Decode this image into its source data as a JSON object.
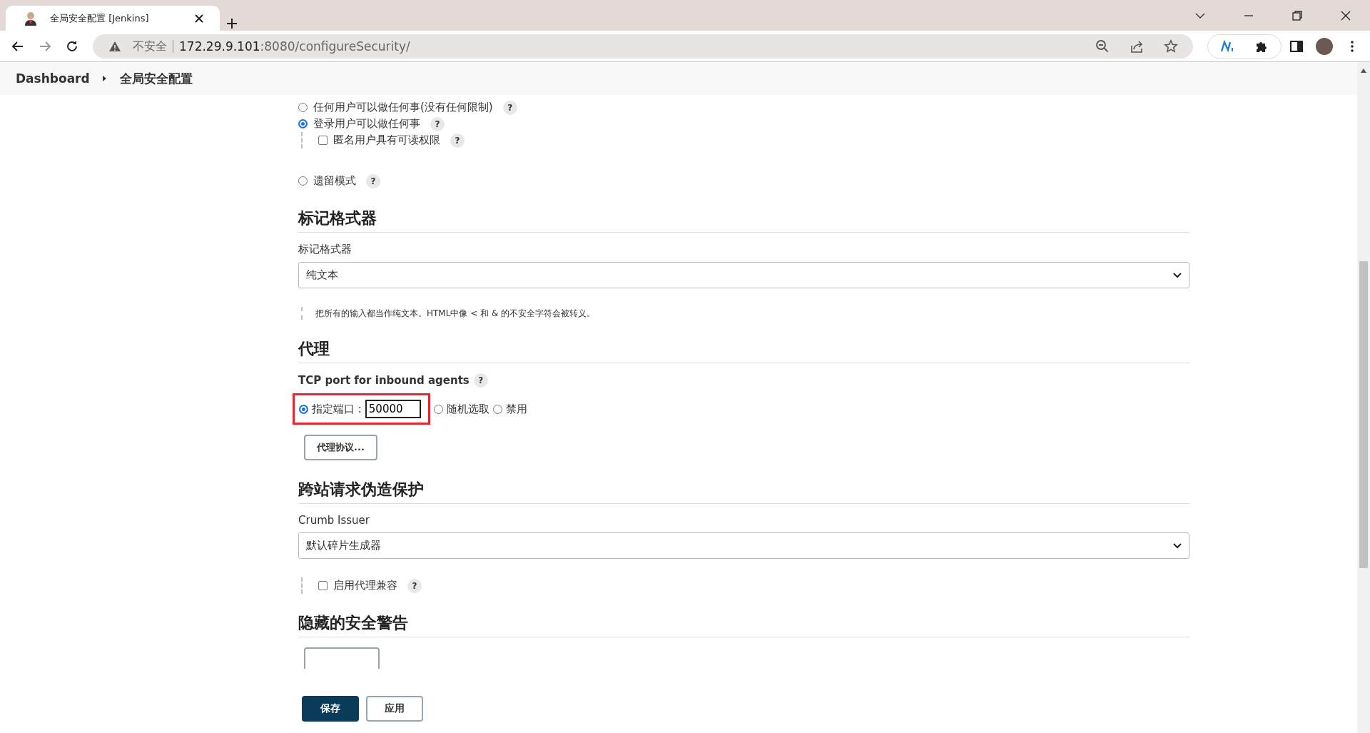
{
  "browser": {
    "tab_title": "全局安全配置 [Jenkins]",
    "security_label": "不安全",
    "url_host": "172.29.9.101",
    "url_rest": ":8080/configureSecurity/"
  },
  "breadcrumb": [
    "Dashboard",
    "全局安全配置"
  ],
  "sections": [
    {
      "kind": "auth",
      "options": [
        {
          "label": "任何用户可以做任何事(没有任何限制)",
          "selected": false,
          "help": "?"
        },
        {
          "label": "登录用户可以做任何事",
          "selected": true,
          "help": "?",
          "children": [
            {
              "label": "匿名用户具有可读权限",
              "checked": false,
              "help": "?"
            }
          ]
        },
        {
          "label": "遗留模式",
          "selected": false,
          "help": "?"
        }
      ]
    },
    {
      "kind": "select",
      "heading": "标记格式器",
      "label": "标记格式器",
      "value": "纯文本",
      "description": "把所有的输入都当作纯文本。HTML中像 < 和 & 的不安全字符会被转义。"
    },
    {
      "kind": "agents",
      "heading": "代理",
      "label": "TCP port for inbound agents",
      "help": "?",
      "highlighted": true,
      "port_options": [
        {
          "label": "指定端口 :",
          "selected": true,
          "value": "50000"
        },
        {
          "label": "随机选取",
          "selected": false
        },
        {
          "label": "禁用",
          "selected": false
        }
      ],
      "button": "代理协议..."
    },
    {
      "kind": "select",
      "heading": "跨站请求伪造保护",
      "label": "Crumb Issuer",
      "value": "默认碎片生成器",
      "checkbox": {
        "label": "启用代理兼容",
        "checked": false,
        "help": "?"
      }
    },
    {
      "kind": "warnings",
      "heading": "隐藏的安全警告"
    }
  ],
  "buttons": [
    {
      "label": "保存",
      "kind": "primary"
    },
    {
      "label": "应用",
      "kind": "secondary"
    }
  ]
}
